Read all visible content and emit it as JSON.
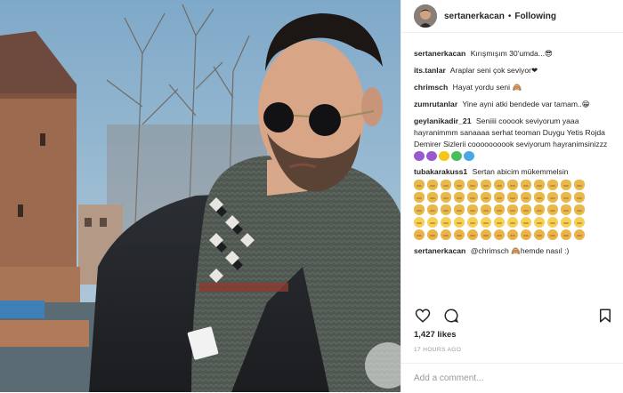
{
  "post": {
    "username": "sertanerkacan",
    "separator": "•",
    "follow_label": "Following",
    "likes": "1,427 likes",
    "time": "17 HOURS AGO",
    "add_comment_placeholder": "Add a comment..."
  },
  "comments": [
    {
      "user": "sertanerkacan",
      "text": "Kırışmışım 30'umda...😎"
    },
    {
      "user": "its.tanlar",
      "text": "Araplar seni çok seviyor❤"
    },
    {
      "user": "chrimsch",
      "text": "Hayat yordu seni 🙈"
    },
    {
      "user": "zumrutanlar",
      "text": "Yine ayni atki bendede var tamam..😁"
    },
    {
      "user": "geylanikadir_21",
      "text": "Seniiii cooook seviyorum yaaa hayranimmm sanaaaa serhat teoman Duygu Yetis Rojda Demirer Sizlerii coooooooook seviyorum hayranimsinizzz"
    },
    {
      "user": "tubakarakuss1",
      "text": "Sertan abicim mükemmelsin"
    },
    {
      "user": "sertanerkacan",
      "text": "@chrimsch 🙈hemde nasıl :)"
    }
  ],
  "colors": {
    "hearts": [
      "#9b59d0",
      "#9b59d0",
      "#f5c518",
      "#4cbb5a",
      "#4aa7e6"
    ],
    "text": "#262626",
    "muted": "#999999",
    "border": "#efefef"
  },
  "icons": {
    "like": "heart-outline-icon",
    "comment": "comment-bubble-icon",
    "save": "bookmark-icon"
  }
}
